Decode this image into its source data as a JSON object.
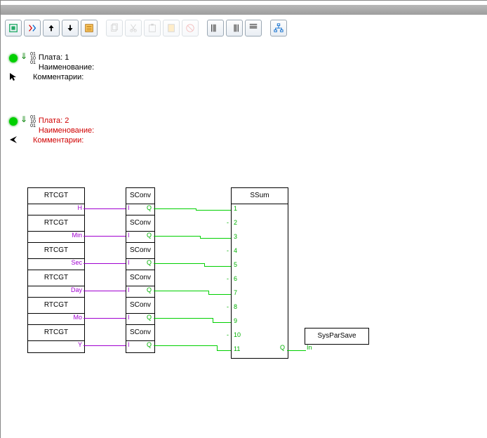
{
  "headers": [
    {
      "board": "Плата: 1",
      "name": "Наименование:",
      "comments": "Комментарии:",
      "color": "black"
    },
    {
      "board": "Плата: 2",
      "name": "Наименование:",
      "comments": "Комментарии:",
      "color": "red"
    }
  ],
  "blocks": {
    "rtcgt": {
      "title": "RTCGT",
      "rows": [
        "H",
        "Min",
        "Sec",
        "Day",
        "Mo",
        "Y"
      ]
    },
    "sconv": {
      "title": "SConv",
      "in": "I",
      "out": "Q"
    },
    "ssum": {
      "title": "SSum",
      "out": "Q",
      "inputs": [
        "1",
        "2",
        "3",
        "4",
        "5",
        "6",
        "7",
        "8",
        "9",
        "10",
        "11"
      ]
    },
    "sys": {
      "title": "SysParSave",
      "in": "In"
    }
  },
  "toolbar": [
    "node",
    "signals",
    "up",
    "down",
    "props",
    "copy",
    "cut",
    "paste",
    "clip",
    "delete",
    "align-l",
    "align-r",
    "align-t",
    "grid"
  ],
  "chart_data": {
    "type": "diagram",
    "nodes": [
      {
        "id": "rtcgt1",
        "type": "RTCGT",
        "out_port": "H"
      },
      {
        "id": "rtcgt2",
        "type": "RTCGT",
        "out_port": "Min"
      },
      {
        "id": "rtcgt3",
        "type": "RTCGT",
        "out_port": "Sec"
      },
      {
        "id": "rtcgt4",
        "type": "RTCGT",
        "out_port": "Day"
      },
      {
        "id": "rtcgt5",
        "type": "RTCGT",
        "out_port": "Mo"
      },
      {
        "id": "rtcgt6",
        "type": "RTCGT",
        "out_port": "Y"
      },
      {
        "id": "sconv1",
        "type": "SConv",
        "in": "I",
        "out": "Q"
      },
      {
        "id": "sconv2",
        "type": "SConv",
        "in": "I",
        "out": "Q"
      },
      {
        "id": "sconv3",
        "type": "SConv",
        "in": "I",
        "out": "Q"
      },
      {
        "id": "sconv4",
        "type": "SConv",
        "in": "I",
        "out": "Q"
      },
      {
        "id": "sconv5",
        "type": "SConv",
        "in": "I",
        "out": "Q"
      },
      {
        "id": "sconv6",
        "type": "SConv",
        "in": "I",
        "out": "Q"
      },
      {
        "id": "ssum",
        "type": "SSum",
        "inputs": 11,
        "out": "Q"
      },
      {
        "id": "sys",
        "type": "SysParSave",
        "in": "In"
      }
    ],
    "edges": [
      {
        "from": "rtcgt1.H",
        "to": "sconv1.I",
        "color": "purple"
      },
      {
        "from": "rtcgt2.Min",
        "to": "sconv2.I",
        "color": "purple"
      },
      {
        "from": "rtcgt3.Sec",
        "to": "sconv3.I",
        "color": "purple"
      },
      {
        "from": "rtcgt4.Day",
        "to": "sconv4.I",
        "color": "purple"
      },
      {
        "from": "rtcgt5.Mo",
        "to": "sconv5.I",
        "color": "purple"
      },
      {
        "from": "rtcgt6.Y",
        "to": "sconv6.I",
        "color": "purple"
      },
      {
        "from": "sconv1.Q",
        "to": "ssum.1",
        "color": "green"
      },
      {
        "from": "sconv2.Q",
        "to": "ssum.3",
        "color": "green"
      },
      {
        "from": "sconv3.Q",
        "to": "ssum.5",
        "color": "green"
      },
      {
        "from": "sconv4.Q",
        "to": "ssum.7",
        "color": "green"
      },
      {
        "from": "sconv5.Q",
        "to": "ssum.9",
        "color": "green"
      },
      {
        "from": "sconv6.Q",
        "to": "ssum.11",
        "color": "green"
      },
      {
        "from": "ssum.Q",
        "to": "sys.In",
        "color": "green"
      }
    ]
  }
}
